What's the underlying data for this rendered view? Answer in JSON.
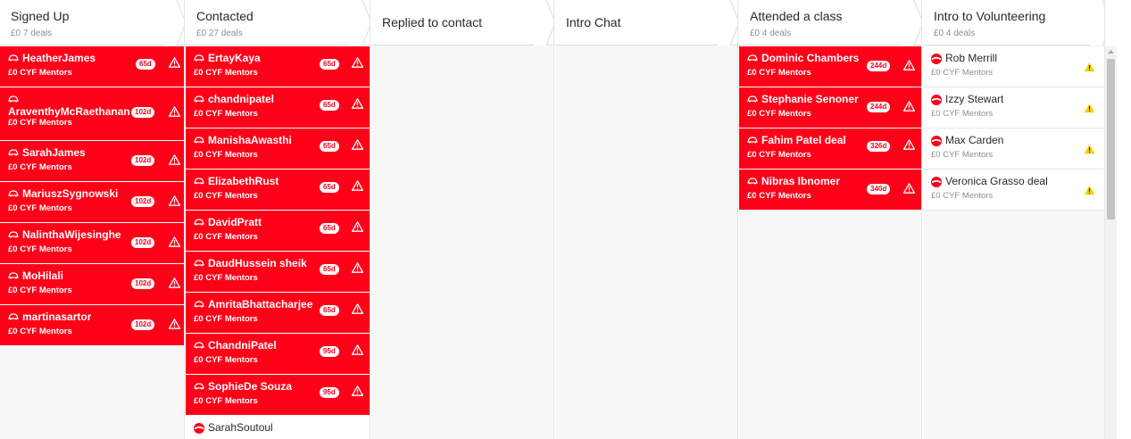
{
  "columns": [
    {
      "title": "Signed Up",
      "subtitle": "£0 7 deals"
    },
    {
      "title": "Contacted",
      "subtitle": "£0 27 deals"
    },
    {
      "title": "Replied to contact",
      "subtitle": ""
    },
    {
      "title": "Intro Chat",
      "subtitle": ""
    },
    {
      "title": "Attended a class",
      "subtitle": "£0 4 deals"
    },
    {
      "title": "Intro to Volunteering",
      "subtitle": "£0 4 deals"
    }
  ],
  "signed_up": [
    {
      "name": "HeatherJames",
      "meta": "£0  CYF Mentors",
      "badge": "65d"
    },
    {
      "name": "AraventhyMcRaethanan",
      "meta": "£0  CYF Mentors",
      "badge": "102d"
    },
    {
      "name": "SarahJames",
      "meta": "£0  CYF Mentors",
      "badge": "102d"
    },
    {
      "name": "MariuszSygnowski",
      "meta": "£0  CYF Mentors",
      "badge": "102d"
    },
    {
      "name": "NalinthaWijesinghe",
      "meta": "£0  CYF Mentors",
      "badge": "102d"
    },
    {
      "name": "MoHilali",
      "meta": "£0  CYF Mentors",
      "badge": "102d"
    },
    {
      "name": "martinasartor",
      "meta": "£0  CYF Mentors",
      "badge": "102d"
    }
  ],
  "contacted": [
    {
      "name": "ErtayKaya",
      "meta": "£0  CYF Mentors",
      "badge": "65d"
    },
    {
      "name": "chandnipatel",
      "meta": "£0  CYF Mentors",
      "badge": "65d"
    },
    {
      "name": "ManishaAwasthi",
      "meta": "£0  CYF Mentors",
      "badge": "65d"
    },
    {
      "name": "ElizabethRust",
      "meta": "£0  CYF Mentors",
      "badge": "65d"
    },
    {
      "name": "DavidPratt",
      "meta": "£0  CYF Mentors",
      "badge": "65d"
    },
    {
      "name": "DaudHussein sheik",
      "meta": "£0  CYF Mentors",
      "badge": "65d"
    },
    {
      "name": "AmritaBhattacharjee",
      "meta": "£0  CYF Mentors",
      "badge": "65d"
    },
    {
      "name": "ChandniPatel",
      "meta": "£0  CYF Mentors",
      "badge": "95d"
    },
    {
      "name": "SophieDe Souza",
      "meta": "£0  CYF Mentors",
      "badge": "95d"
    },
    {
      "name": "SarahSoutoul",
      "meta": "",
      "badge": ""
    }
  ],
  "attended": [
    {
      "name": "Dominic Chambers",
      "meta": "£0  CYF Mentors",
      "badge": "244d"
    },
    {
      "name": "Stephanie Senoner",
      "meta": "£0  CYF Mentors",
      "badge": "244d"
    },
    {
      "name": "Fahim Patel deal",
      "meta": "£0  CYF Mentors",
      "badge": "326d"
    },
    {
      "name": "Nibras Ibnomer",
      "meta": "£0  CYF Mentors",
      "badge": "340d"
    }
  ],
  "volunteering": [
    {
      "name": "Rob Merrill",
      "meta": "£0  CYF Mentors"
    },
    {
      "name": "Izzy Stewart",
      "meta": "£0  CYF Mentors"
    },
    {
      "name": "Max Carden",
      "meta": "£0  CYF Mentors"
    },
    {
      "name": "Veronica Grasso deal",
      "meta": "£0  CYF Mentors"
    }
  ],
  "colors": {
    "accent_red": "#ff0019",
    "warning_yellow": "#f6d500"
  }
}
